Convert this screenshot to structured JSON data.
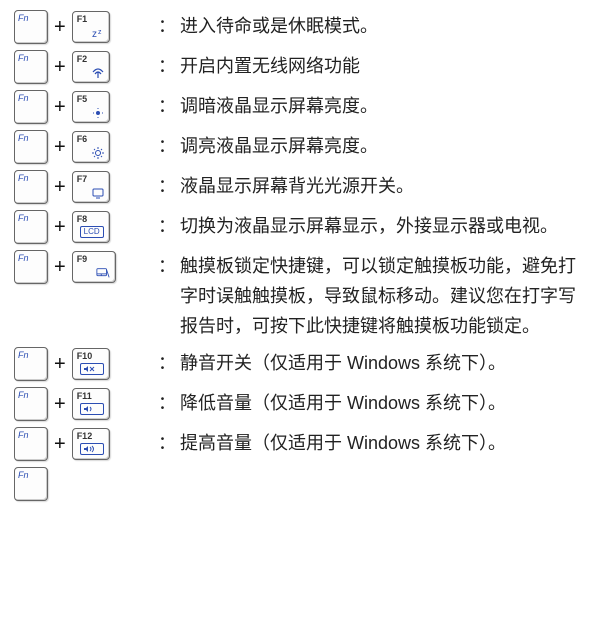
{
  "fn_label": "Fn",
  "plus": "+",
  "colon": "：",
  "rows": [
    {
      "fkey": "F1",
      "desc": "进入待命或是休眠模式。"
    },
    {
      "fkey": "F2",
      "desc": "开启内置无线网络功能"
    },
    {
      "fkey": "F5",
      "desc": "调暗液晶显示屏幕亮度。"
    },
    {
      "fkey": "F6",
      "desc": "调亮液晶显示屏幕亮度。"
    },
    {
      "fkey": "F7",
      "desc": "液晶显示屏幕背光光源开关。"
    },
    {
      "fkey": "F8",
      "desc": "切换为液晶显示屏幕显示，外接显示器或电视。"
    },
    {
      "fkey": "F9",
      "desc": "触摸板锁定快捷键，可以锁定触摸板功能，避免打字时误触触摸板，导致鼠标移动。建议您在打字写报告时，可按下此快捷键将触摸板功能锁定。"
    },
    {
      "fkey": "F10",
      "desc": "静音开关（仅适用于 Windows 系统下）。"
    },
    {
      "fkey": "F11",
      "desc": "降低音量（仅适用于 Windows 系统下）。"
    },
    {
      "fkey": "F12",
      "desc": "提高音量（仅适用于 Windows 系统下）。"
    }
  ]
}
